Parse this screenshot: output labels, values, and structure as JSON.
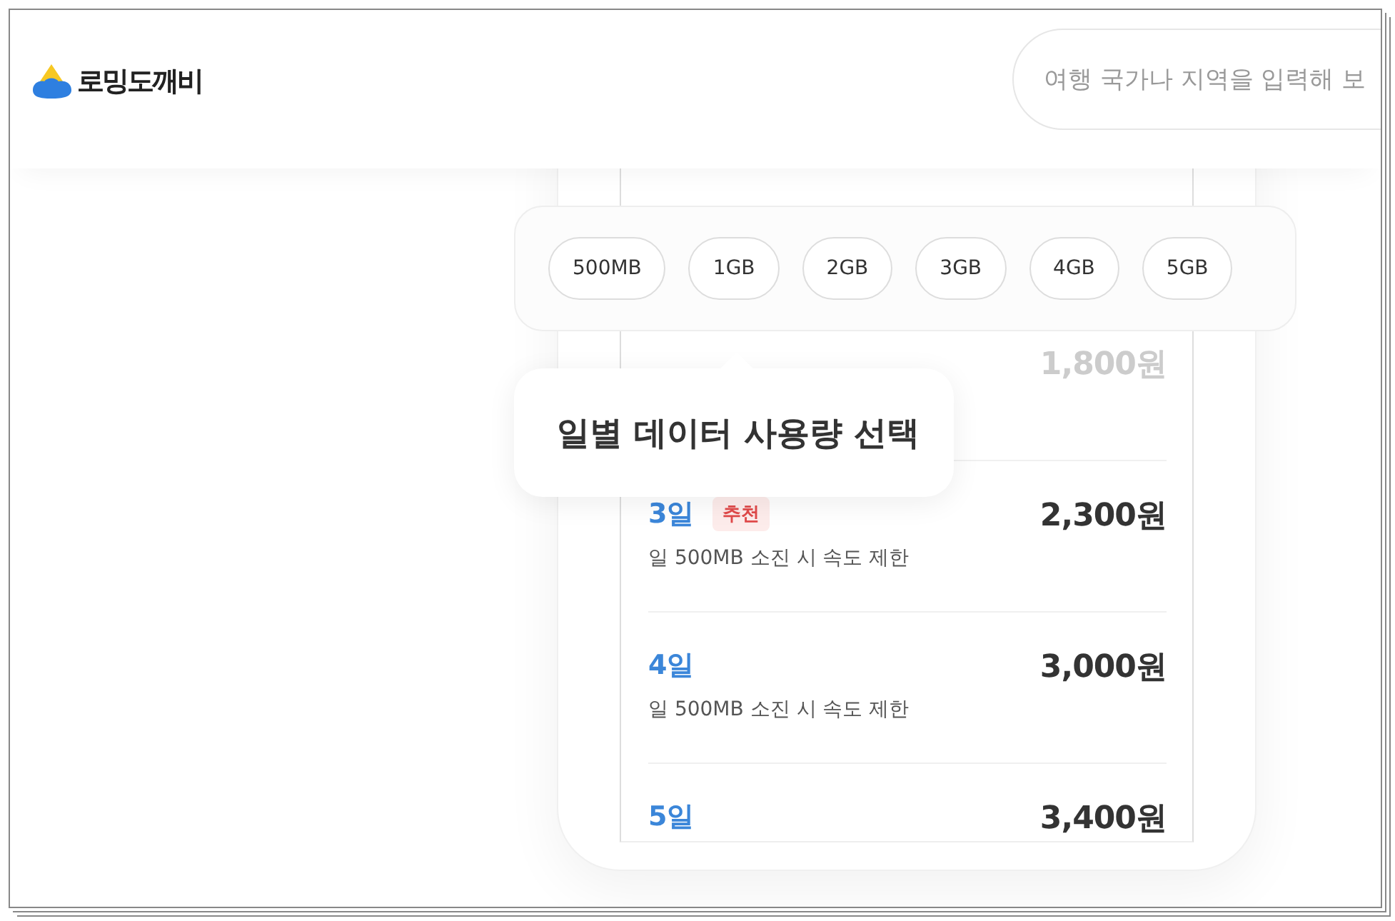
{
  "header": {
    "logo_text": "로밍도깨비",
    "search": {
      "placeholder": "여행 국가나 지역을 입력해 보"
    }
  },
  "plans": [
    {
      "price": "1,800원",
      "dimmed": true
    },
    {
      "day": "3일",
      "badge": "추천",
      "description": "일 500MB 소진 시 속도 제한",
      "price": "2,300원",
      "dimmed": false
    },
    {
      "day": "4일",
      "description": "일 500MB 소진 시 속도 제한",
      "price": "3,000원",
      "dimmed": false
    },
    {
      "day": "5일",
      "price": "3,400원",
      "dimmed": false
    }
  ],
  "data_sizes": [
    "500MB",
    "1GB",
    "2GB",
    "3GB",
    "4GB",
    "5GB"
  ],
  "tooltip": "일별 데이터 사용량 선택"
}
